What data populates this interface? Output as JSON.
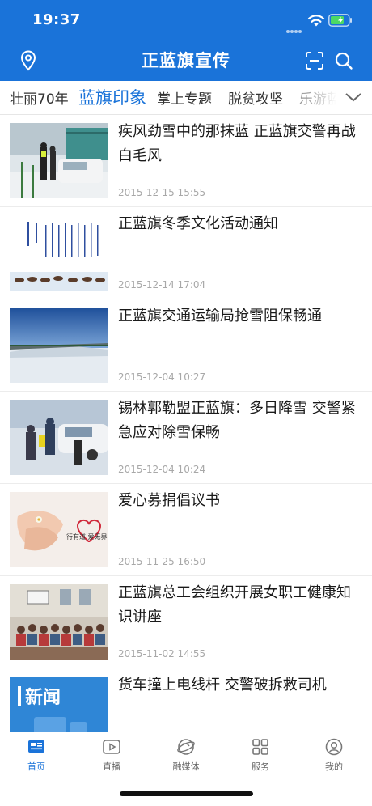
{
  "status_bar": {
    "time": "19:37"
  },
  "nav": {
    "title": "正蓝旗宣传"
  },
  "colors": {
    "brand": "#1a73d9",
    "date": "#a8a8a8"
  },
  "icons": {
    "location": "location-pin-icon",
    "scan": "scan-icon",
    "search": "search-icon",
    "expand": "chevron-down-icon"
  },
  "tabs": [
    {
      "label": "壮丽70年"
    },
    {
      "label": "蓝旗印象"
    },
    {
      "label": "掌上专题"
    },
    {
      "label": "脱贫攻坚"
    },
    {
      "label": "乐游蓝"
    }
  ],
  "active_tab": "蓝旗印象",
  "articles": [
    {
      "title": "疾风劲雪中的那抹蓝 正蓝旗交警再战白毛风",
      "date": "2015-12-15 15:55",
      "thumb": "snowy-car-officers"
    },
    {
      "title": "正蓝旗冬季文化活动通知",
      "date": "2015-12-14 17:04",
      "thumb": "mongolian-script-poster"
    },
    {
      "title": "正蓝旗交通运输局抢雪阻保畅通",
      "date": "2015-12-04 10:27",
      "thumb": "snowy-road"
    },
    {
      "title": "锡林郭勒盟正蓝旗：多日降雪 交警紧急应对除雪保畅",
      "date": "2015-12-04 10:24",
      "thumb": "pushing-car-snow"
    },
    {
      "title": "爱心募捐倡议书",
      "date": "2015-11-25 16:50",
      "thumb": "charity-hands",
      "thumb_caption": "行有道 爱无界"
    },
    {
      "title": "正蓝旗总工会组织开展女职工健康知识讲座",
      "date": "2015-11-02 14:55",
      "thumb": "lecture-hall"
    },
    {
      "title": "货车撞上电线杆 交警破拆救司机",
      "date": "",
      "thumb": "news-placeholder",
      "thumb_caption": "新闻"
    }
  ],
  "bottom_nav": [
    {
      "label": "首页",
      "icon": "home-news-icon",
      "active": true
    },
    {
      "label": "直播",
      "icon": "live-play-icon",
      "active": false
    },
    {
      "label": "融媒体",
      "icon": "media-globe-icon",
      "active": false
    },
    {
      "label": "服务",
      "icon": "services-grid-icon",
      "active": false
    },
    {
      "label": "我的",
      "icon": "profile-icon",
      "active": false
    }
  ]
}
